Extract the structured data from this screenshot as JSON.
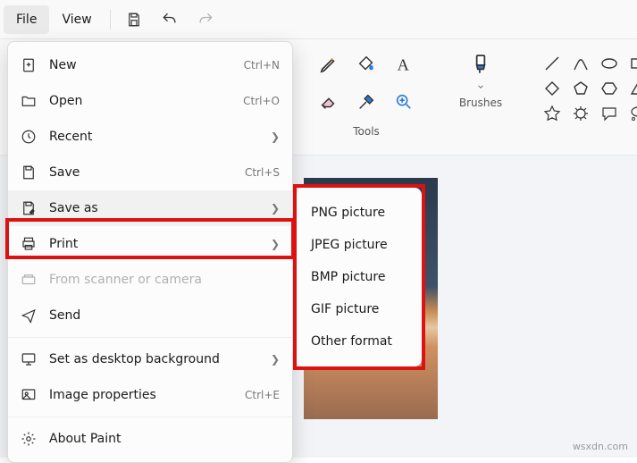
{
  "menubar": {
    "file": "File",
    "view": "View"
  },
  "file_menu": {
    "new": "New",
    "new_kbd": "Ctrl+N",
    "open": "Open",
    "open_kbd": "Ctrl+O",
    "recent": "Recent",
    "save": "Save",
    "save_kbd": "Ctrl+S",
    "save_as": "Save as",
    "print": "Print",
    "scanner": "From scanner or camera",
    "send": "Send",
    "set_bg": "Set as desktop background",
    "img_props": "Image properties",
    "img_props_kbd": "Ctrl+E",
    "about": "About Paint"
  },
  "saveas_submenu": {
    "png": "PNG picture",
    "jpeg": "JPEG picture",
    "bmp": "BMP picture",
    "gif": "GIF picture",
    "other": "Other format"
  },
  "ribbon": {
    "tools_label": "Tools",
    "brushes_label": "Brushes"
  },
  "watermark": "wsxdn.com"
}
